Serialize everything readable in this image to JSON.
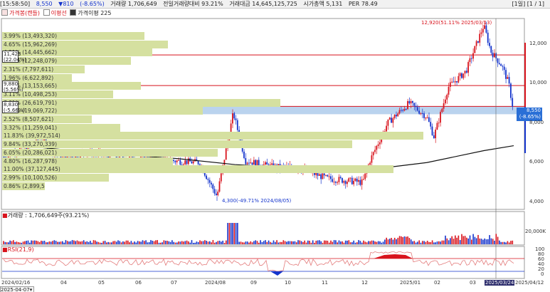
{
  "topbar": {
    "time": "[15:58:50]",
    "price": "8,550",
    "change": "▼810",
    "change_pct": "(-8.65%)",
    "volume": "거래량 1,706,649",
    "vol_ratio": "전일거래량대비 93.21%",
    "amount": "거래대금 14,645,125,725",
    "mktcap": "시가총액 5,131",
    "per": "PER 78.49",
    "page": "[1일] [1 / 1]"
  },
  "legend": {
    "item1": "가격봉(캔들)",
    "item2": "이평선",
    "item3": "가격이평 225"
  },
  "volume_profile": [
    {
      "label": "3.99% (13,493,320)"
    },
    {
      "label": "4.65% (15,962,269)"
    },
    {
      "label": "4.21% (14,445,662)"
    },
    {
      "label": "3.62% (12,248,079)"
    },
    {
      "label": "2.31% (7,797,611)"
    },
    {
      "label": "1.96% (6,622,892)"
    },
    {
      "label": "3.89% (13,153,665)"
    },
    {
      "label": "3.11% (10,498,253)"
    },
    {
      "label": "7.81% (26,619,791)"
    },
    {
      "label": "5.64% (19,069,722)"
    },
    {
      "label": "2.52% (8,507,621)"
    },
    {
      "label": "3.32% (11,259,041)"
    },
    {
      "label": "11.83% (39,972,514)"
    },
    {
      "label": "9.84% (33,270,339)"
    },
    {
      "label": "6.05% (20,286,021)"
    },
    {
      "label": "4.80% (16,287,978)"
    },
    {
      "label": "11.00% (37,127,445)"
    },
    {
      "label": "2.99% (10,100,526)"
    },
    {
      "label": "0.86% (2,899,501)"
    }
  ],
  "levels": {
    "high_box": "11,423\n(22.04%)",
    "mid_box": "9,880\n(5.56%)",
    "low_box": "8,830\n(-5.66%)"
  },
  "annotations": {
    "high": "12,920(51.11% 2025/03/13)",
    "low": "4,300(-49.71% 2024/08/05)"
  },
  "price_tag": {
    "price": "8,550",
    "pct": "(-8.65%)"
  },
  "y_axis": [
    "12,000",
    "10,000",
    "8,000",
    "6,000",
    "4,000"
  ],
  "volume_panel": {
    "title": "거래량 : 1,706,649주(93.21%)",
    "ticks": [
      "20,000K"
    ]
  },
  "rsi_panel": {
    "title": "RSI(21,9)",
    "ticks": [
      "100",
      "80",
      "60",
      "40",
      "20",
      "0"
    ]
  },
  "x_axis": [
    "2024/02/16",
    "04",
    "05",
    "06",
    "07",
    "2024/08",
    "09",
    "10",
    "11",
    "12",
    "2025/01",
    "02",
    "03",
    "2025/03/24",
    "2025/04/12"
  ],
  "bottom_date": "2025-04-07",
  "colors": {
    "up": "#d8131c",
    "down": "#1434cc",
    "band": "#d5e0a0",
    "current": "#2a6fd6"
  }
}
